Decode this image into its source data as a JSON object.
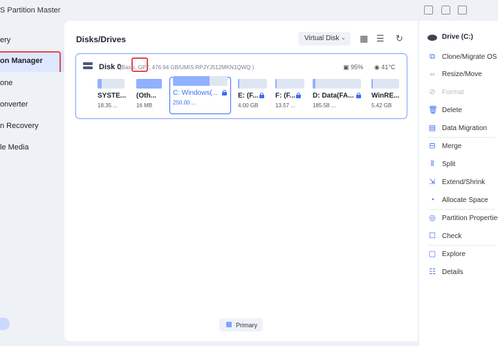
{
  "app": {
    "title": "S Partition Master"
  },
  "sidebar": {
    "items": [
      {
        "label": "ery"
      },
      {
        "label": "on Manager"
      },
      {
        "label": "one"
      },
      {
        "label": "onverter"
      },
      {
        "label": "n Recovery"
      },
      {
        "label": "le Media"
      }
    ]
  },
  "main": {
    "title": "Disks/Drives",
    "virtual_disk_label": "Virtual Disk",
    "legend_label": "Primary"
  },
  "disk": {
    "name": "Disk 0",
    "info": "(Basic, GPT, 476.94 GB/UMIS RPJYJ512MKN1QWQ )",
    "health": "95%",
    "temperature": "41°C",
    "partitions": [
      {
        "name": "SYSTE...",
        "size": "18.35 ...",
        "fill": 0.15
      },
      {
        "name": "(Oth...",
        "size": "16 MB",
        "fill": 1.0
      },
      {
        "name": "C: Windows(...",
        "size": "250.00 ...",
        "fill": 0.67,
        "locked": true,
        "selected": true
      },
      {
        "name": "E: (F...",
        "size": "4.00 GB",
        "fill": 0.04,
        "locked": true
      },
      {
        "name": "F: (F...",
        "size": "13.57 ...",
        "fill": 0.04,
        "locked": true
      },
      {
        "name": "D: Data(FA...",
        "size": "185.58 ...",
        "fill": 0.06,
        "locked": true
      },
      {
        "name": "WinRE...",
        "size": "5.42 GB",
        "fill": 0.06
      }
    ]
  },
  "actions": {
    "drive_label": "Drive (C:)",
    "items": [
      {
        "label": "Clone/Migrate OS",
        "icon": "clone-icon",
        "glyph": "⧉",
        "enabled": true
      },
      {
        "label": "Resize/Move",
        "icon": "resize-icon",
        "glyph": "⇔",
        "enabled": true
      },
      {
        "label": "Format",
        "icon": "format-icon",
        "glyph": "⊘",
        "enabled": false
      },
      {
        "label": "Delete",
        "icon": "trash-icon",
        "glyph": "🗑",
        "enabled": true
      },
      {
        "label": "Data Migration",
        "icon": "data-migration-icon",
        "glyph": "▤",
        "enabled": true
      },
      {
        "label": "Merge",
        "icon": "merge-icon",
        "glyph": "⊟",
        "enabled": true
      },
      {
        "label": "Split",
        "icon": "split-icon",
        "glyph": "⫴",
        "enabled": true
      },
      {
        "label": "Extend/Shrink",
        "icon": "extend-icon",
        "glyph": "⇲",
        "enabled": true
      },
      {
        "label": "Allocate Space",
        "icon": "allocate-icon",
        "glyph": "◔",
        "enabled": true
      },
      {
        "label": "Partition Properties",
        "icon": "properties-icon",
        "glyph": "◎",
        "enabled": true
      },
      {
        "label": "Check",
        "icon": "check-icon",
        "glyph": "☐",
        "enabled": true
      },
      {
        "label": "Explore",
        "icon": "explore-icon",
        "glyph": "▢",
        "enabled": true
      },
      {
        "label": "Details",
        "icon": "details-icon",
        "glyph": "☷",
        "enabled": true
      }
    ]
  },
  "colors": {
    "accent": "#3a6df0",
    "highlight": "#e5484d",
    "bar_fill": "#8fb1ff"
  }
}
